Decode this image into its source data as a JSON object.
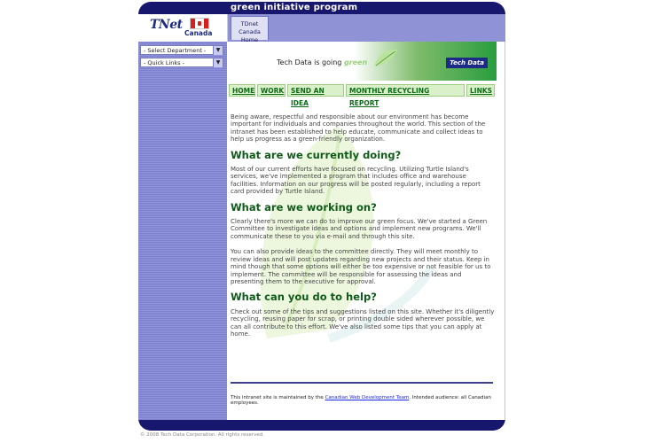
{
  "header": {
    "title": "green initiative program",
    "logo_text": "TNet",
    "logo_sub": "Canada",
    "tab_home_label": "TDnet Canada Home"
  },
  "sidebar": {
    "selects": [
      {
        "label": "- Select Department -"
      },
      {
        "label": "- Quick Links -"
      }
    ]
  },
  "banner": {
    "going_prefix": "Tech Data is going ",
    "going_word": "green",
    "brand": "Tech Data"
  },
  "nav": {
    "items": [
      "HOME",
      "WORK",
      "SEND AN IDEA",
      "MONTHLY RECYCLING REPORT",
      "LINKS"
    ]
  },
  "content": {
    "intro": "Being aware, respectful and responsible about our environment has become important for individuals and companies throughout the world. This section of the intranet has been established to help educate, communicate and collect ideas to help us progress as a green-friendly organization.",
    "h1": "What are we currently doing?",
    "p1": "Most of our current efforts have focused on recycling. Utilizing Turtle Island's services, we've implemented a program that includes office and warehouse facilities. Information on our progress will be posted regularly, including a report card provided by Turtle Island.",
    "h2": "What are we working on?",
    "p2": "Clearly there's more we can do to improve our green focus. We've started a Green Committee to investigate ideas and options and implement new programs. We'll communicate these to you via e-mail and through this site.",
    "p3": "You can also provide ideas to the committee directly. They will meet monthly to review ideas and will post updates regarding new projects and their status. Keep in mind though that some options will either be too expensive or not feasible for us to implement. The committee will be responsible for assessing the ideas and presenting them to the executive for approval.",
    "h3": "What can you do to help?",
    "p4": "Check out some of the tips and suggestions listed on this site. Whether it's diligently recycling, reusing paper for scrap, or printing double sided wherever possible, we can all contribute to this effort. We've also listed some tips that you can apply at home."
  },
  "footer": {
    "prefix": "This intranet site is maintained by the ",
    "link": "Canadian Web Development Team",
    "suffix": ". Intended audience: all Canadian employees."
  },
  "copyright": "© 2008 Tech Data Corporation. All rights reserved.",
  "colors": {
    "navy": "#17176e",
    "sidebar": "#8e92d8",
    "heading_green": "#0f5c1a",
    "nav_green": "#0b6a16"
  }
}
